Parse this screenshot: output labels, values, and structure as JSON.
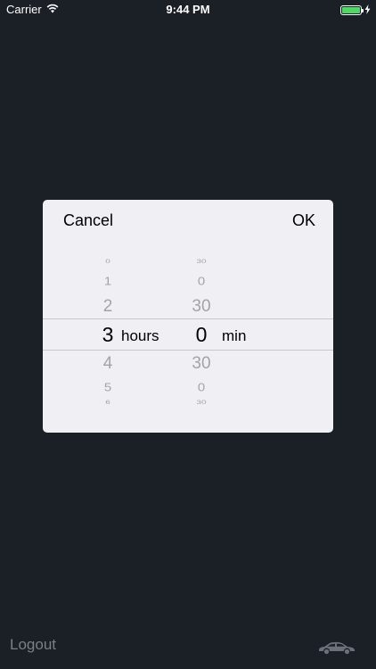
{
  "status_bar": {
    "carrier": "Carrier",
    "time": "9:44 PM"
  },
  "dialog": {
    "cancel_label": "Cancel",
    "ok_label": "OK"
  },
  "picker": {
    "hours": {
      "values": [
        "0",
        "1",
        "2",
        "3",
        "4",
        "5",
        "6"
      ],
      "selected": "3",
      "unit": "hours"
    },
    "minutes": {
      "values": [
        "30",
        "0",
        "30",
        "0",
        "30",
        "0",
        "30"
      ],
      "selected": "0",
      "unit": "min"
    }
  },
  "footer": {
    "logout_label": "Logout"
  },
  "colors": {
    "background": "#1b1f26",
    "dialog": "#efeff4",
    "battery": "#4cd964"
  }
}
